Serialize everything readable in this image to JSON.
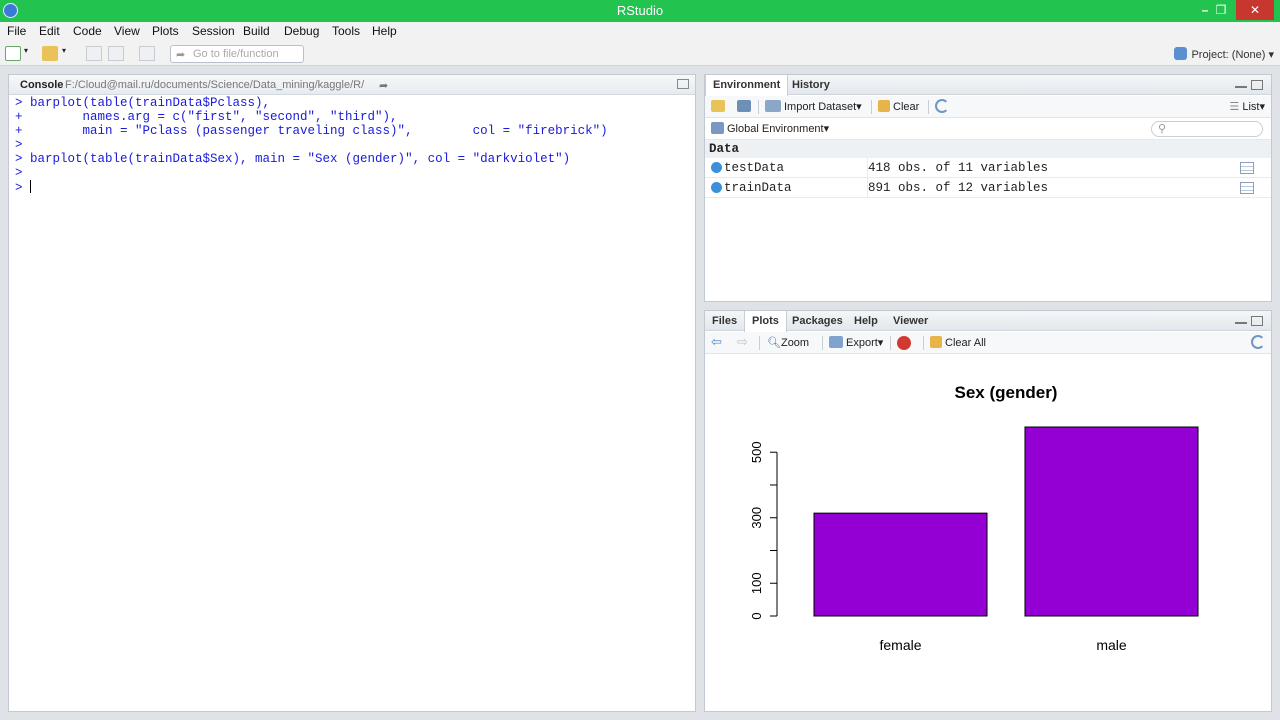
{
  "window": {
    "title": "RStudio",
    "min": "–",
    "max": "❐",
    "close": "✕"
  },
  "menu": [
    "File",
    "Edit",
    "Code",
    "View",
    "Plots",
    "Session",
    "Build",
    "Debug",
    "Tools",
    "Help"
  ],
  "toolbar": {
    "goto_placeholder": "Go to file/function",
    "project": "Project: (None)"
  },
  "console": {
    "title": "Console",
    "path": "F:/Cloud@mail.ru/documents/Science/Data_mining/kaggle/R/",
    "lines": [
      "> barplot(table(trainData$Pclass),",
      "+        names.arg = c(\"first\", \"second\", \"third\"),",
      "+        main = \"Pclass (passenger traveling class)\",        col = \"firebrick\")",
      ">",
      "> barplot(table(trainData$Sex), main = \"Sex (gender)\", col = \"darkviolet\")",
      ">",
      "> "
    ]
  },
  "env_pane": {
    "tabs": [
      "Environment",
      "History"
    ],
    "import_dataset": "Import Dataset",
    "clear": "Clear",
    "list_view": "List",
    "scope": "Global Environment",
    "section": "Data",
    "rows": [
      {
        "name": "testData",
        "value": "418 obs. of 11 variables"
      },
      {
        "name": "trainData",
        "value": "891 obs. of 12 variables"
      }
    ]
  },
  "plots_pane": {
    "tabs": [
      "Files",
      "Plots",
      "Packages",
      "Help",
      "Viewer"
    ],
    "zoom": "Zoom",
    "export": "Export",
    "clear_all": "Clear All"
  },
  "chart_data": {
    "type": "bar",
    "title": "Sex (gender)",
    "categories": [
      "female",
      "male"
    ],
    "values": [
      314,
      577
    ],
    "bar_color": "#9400D3",
    "y_ticks": [
      0,
      100,
      200,
      300,
      400,
      500
    ],
    "y_tick_labels": [
      "0",
      "100",
      "",
      "300",
      "",
      "500"
    ],
    "ylim": [
      0,
      577
    ],
    "xlabel": "",
    "ylabel": ""
  }
}
